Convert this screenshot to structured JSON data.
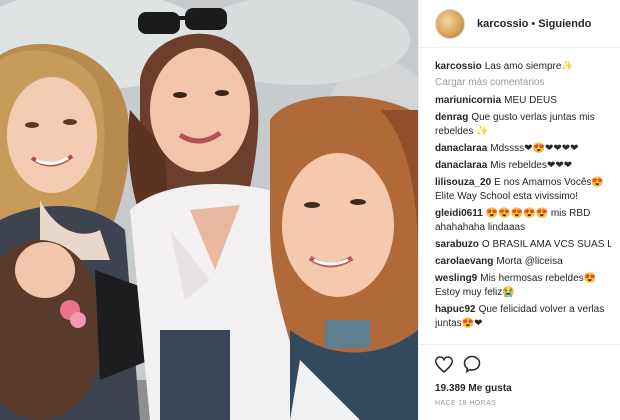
{
  "post": {
    "username": "karcossio",
    "separator": "•",
    "follow_state": "Siguiendo"
  },
  "caption": {
    "user": "karcossio",
    "text": "Las amo siempre✨"
  },
  "load_more": "Cargar más comentarios",
  "comments": [
    {
      "user": "mariunicornia",
      "text": "MEU DEUS"
    },
    {
      "user": "denrag",
      "text": "Que gusto verlas juntas mis rebeldes ✨"
    },
    {
      "user": "danaclaraa",
      "text": "Mdssss❤😍❤❤❤❤"
    },
    {
      "user": "danaclaraa",
      "text": "Mis rebeldes❤❤❤"
    },
    {
      "user": "lilisouza_20",
      "text": "E nos Amamos Vocês😍 Elite Way School esta vivissimo!"
    },
    {
      "user": "gleidi0611",
      "text": "😍😍😍😍😍 mis RBD ahahahaha lindaaas"
    },
    {
      "user": "sarabuzo",
      "text": "O BRASIL AMA VCS SUAS LINDAS"
    },
    {
      "user": "carolaevang",
      "text": "Morta @liceisa"
    },
    {
      "user": "wesling9",
      "text": "Mis hermosas rebeldes😍 Estoy muy feliz😭"
    },
    {
      "user": "hapuc92",
      "text": "Que felicidad volver a verlas juntas😍❤"
    }
  ],
  "likes": "19.389 Me gusta",
  "time_ago": "HACE 18 HORAS",
  "icons": {
    "like": "heart-outline-icon",
    "comment": "speech-bubble-icon"
  }
}
